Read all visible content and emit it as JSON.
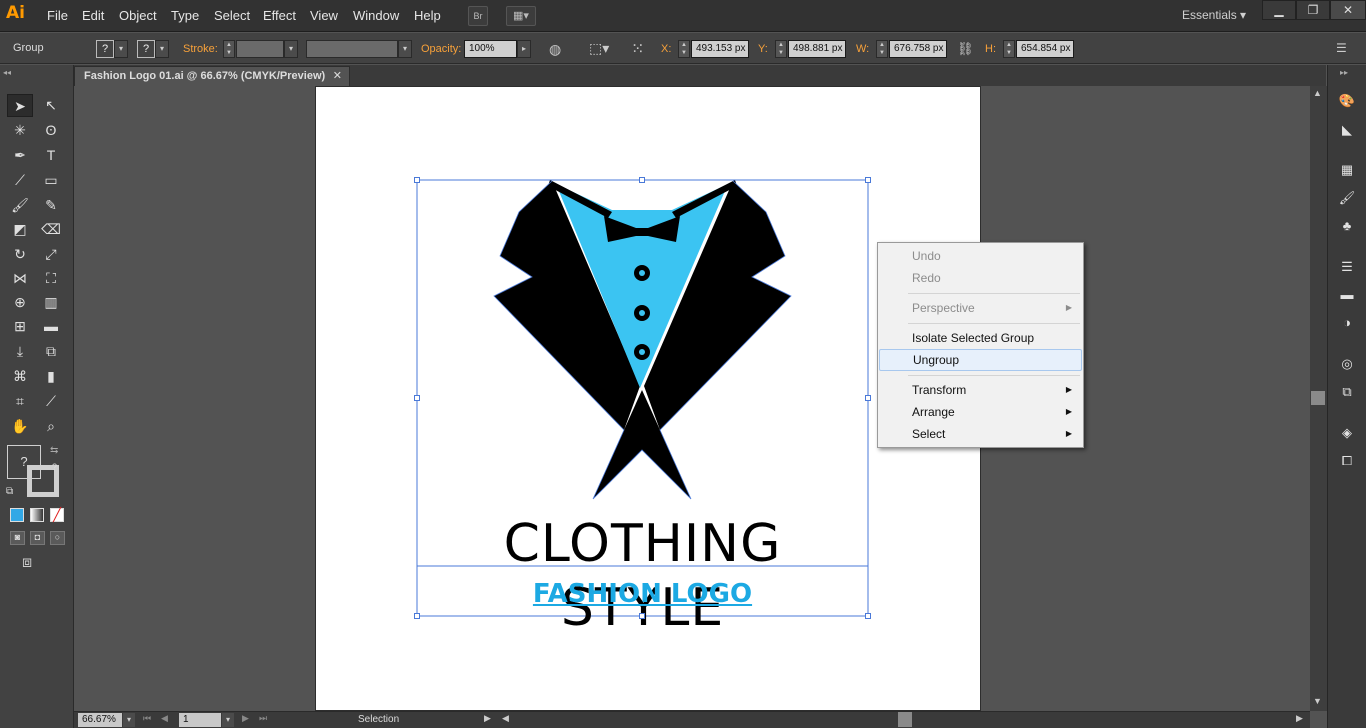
{
  "app": {
    "logo": "Ai"
  },
  "menubar": {
    "items": [
      "File",
      "Edit",
      "Object",
      "Type",
      "Select",
      "Effect",
      "View",
      "Window",
      "Help"
    ],
    "bridge_label": "Br",
    "workspace": "Essentials"
  },
  "control_bar": {
    "selection_type": "Group",
    "fill_value": "?",
    "stroke_swatch_value": "?",
    "stroke_label": "Stroke:",
    "opacity_label": "Opacity:",
    "opacity_value": "100%",
    "x_label": "X:",
    "x_value": "493.153 px",
    "y_label": "Y:",
    "y_value": "498.881 px",
    "w_label": "W:",
    "w_value": "676.758 px",
    "h_label": "H:",
    "h_value": "654.854 px"
  },
  "document": {
    "tab_title": "Fashion Logo 01.ai @ 66.67% (CMYK/Preview)"
  },
  "artwork": {
    "title": "CLOTHING STYLE",
    "subtitle": "FASHION LOGO",
    "colors": {
      "black": "#000000",
      "cyan": "#3bc4f2",
      "subtitle": "#1ca9e3",
      "selection": "#4a79d8"
    }
  },
  "toolbox": {
    "fill_stroke_value": "?"
  },
  "context_menu": {
    "items": [
      {
        "label": "Undo",
        "enabled": false
      },
      {
        "label": "Redo",
        "enabled": false
      },
      {
        "label": "Perspective",
        "enabled": false,
        "submenu": true
      },
      {
        "label": "Isolate Selected Group",
        "enabled": true
      },
      {
        "label": "Ungroup",
        "enabled": true,
        "highlighted": true
      },
      {
        "label": "Transform",
        "enabled": true,
        "submenu": true
      },
      {
        "label": "Arrange",
        "enabled": true,
        "submenu": true
      },
      {
        "label": "Select",
        "enabled": true,
        "submenu": true
      }
    ]
  },
  "statusbar": {
    "zoom": "66.67%",
    "artboard_number": "1",
    "current_tool": "Selection"
  }
}
